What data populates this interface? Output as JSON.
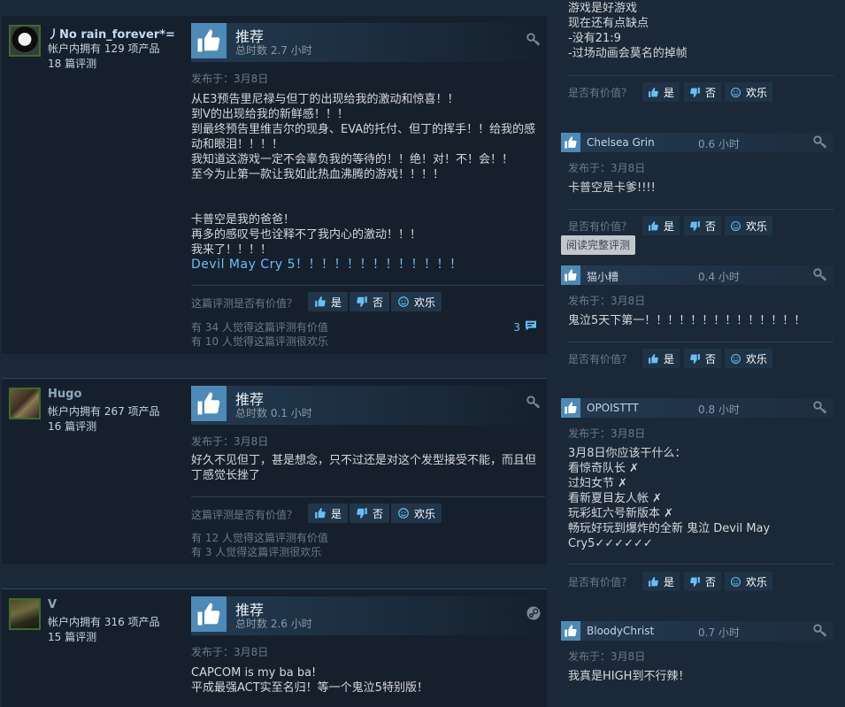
{
  "reviews": [
    {
      "author": "丿No rain_forever*=",
      "products": "帐户内拥有 129 项产品",
      "review_count": "18 篇评测",
      "verdict": "推荐",
      "hours": "总时数 2.7 小时",
      "posted": "发布于：3月8日",
      "lines": [
        "从E3预告里尼禄与但丁的出现给我的激动和惊喜！！",
        "到V的出现给我的新鲜感！！！",
        "到最终预告里维吉尔的现身、EVA的托付、但丁的挥手！！给我的感动和眼泪！！！！",
        "我知道这游戏一定不会辜负我的等待的！！绝！对！不！会！！",
        "至今为止第一款让我如此热血沸腾的游戏！！！！",
        "",
        "卡普空是我的爸爸！",
        "再多的感叹号也诠释不了我内心的激动！！！",
        "我来了！！！！"
      ],
      "blue_line": "Devil May Cry 5！！！！！！！！！！！！！",
      "helpful_question": "这篇评测是否有价值？",
      "yes": "是",
      "no": "否",
      "funny": "欢乐",
      "helpful_stat": "有 34 人觉得这篇评测有价值",
      "funny_stat": "有 10 人觉得这篇评测很欢乐",
      "comments": "3"
    },
    {
      "author": "Hugo",
      "products": "帐户内拥有 267 项产品",
      "review_count": "16 篇评测",
      "verdict": "推荐",
      "hours": "总时数 0.1 小时",
      "posted": "发布于：3月8日",
      "lines": [
        "好久不见但丁，甚是想念，只不过还是对这个发型接受不能，而且但丁感觉长挫了"
      ],
      "helpful_question": "这篇评测是否有价值？",
      "yes": "是",
      "no": "否",
      "funny": "欢乐",
      "helpful_stat": "有 12 人觉得这篇评测有价值",
      "funny_stat": "有 3 人觉得这篇评测很欢乐"
    },
    {
      "author": "V",
      "products": "帐户内拥有 316 项产品",
      "review_count": "15 篇评测",
      "verdict": "推荐",
      "hours": "总时数 2.6 小时",
      "posted": "发布于：3月8日",
      "lines": [
        "CAPCOM is my ba ba!",
        "平成最强ACT实至名归！等一个鬼泣5特别版！"
      ]
    }
  ],
  "side": {
    "top_lines": [
      "游戏是好游戏",
      "现在还有点缺点",
      "-没有21:9",
      "-过场动画会莫名的掉帧"
    ],
    "helpful_question": "是否有价值？",
    "yes": "是",
    "no": "否",
    "funny": "欢乐",
    "tooltip": "阅读完整评测",
    "cards": [
      {
        "name": "Chelsea Grin",
        "hours": "0.6 小时",
        "posted": "发布于：3月8日",
        "lines": [
          "卡普空是卡爹!!!!"
        ]
      },
      {
        "name": "猫小糟",
        "hours": "0.4 小时",
        "posted": "发布于：3月8日",
        "lines": [
          "鬼泣5天下第一！！！！！！！！！！！！！！"
        ]
      },
      {
        "name": "OPOISTTT",
        "hours": "0.8 小时",
        "posted": "发布于：3月8日",
        "lines": [
          "3月8日你应该干什么：",
          "看惊奇队长 ✗",
          "过妇女节 ✗",
          "看新夏目友人帐 ✗",
          "玩彩虹六号新版本 ✗",
          "畅玩好玩到爆炸的全新 鬼泣 Devil May",
          "Cry5✓✓✓✓✓✓"
        ]
      },
      {
        "name": "BloodyChrist",
        "hours": "0.7 小时",
        "posted": "发布于：3月8日",
        "lines": [
          "我真是HIGH到不行辣！"
        ]
      }
    ]
  }
}
